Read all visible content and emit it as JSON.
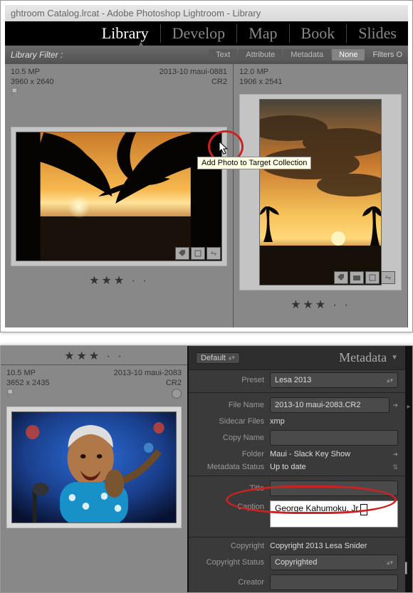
{
  "window": {
    "title": "ghtroom Catalog.lrcat - Adobe Photoshop Lightroom - Library"
  },
  "modules": {
    "items": [
      "Library",
      "Develop",
      "Map",
      "Book",
      "Slides"
    ],
    "active": "Library"
  },
  "filterbar": {
    "label": "Library Filter :",
    "tabs": [
      "Text",
      "Attribute",
      "Metadata",
      "None"
    ],
    "selected": "None",
    "right": "Filters O"
  },
  "grid": {
    "thumbs": [
      {
        "mp": "10.5 MP",
        "name": "2013-10 maui-0881",
        "dims": "3960 x 2640",
        "ext": "CR2",
        "stars": "★★★ · ·",
        "tooltip": "Add Photo to Target Collection"
      },
      {
        "mp": "12.0 MP",
        "name": "",
        "dims": "1906 x 2541",
        "ext": "",
        "stars": "★★★ · ·"
      }
    ]
  },
  "lower": {
    "thumb": {
      "mp": "10.5 MP",
      "name": "2013-10 maui-2083",
      "dims": "3652 x 2435",
      "ext": "CR2",
      "stars": "★★★ · ·"
    },
    "panel": {
      "title": "Metadata",
      "headerSelect": "Default",
      "rows": {
        "preset_lbl": "Preset",
        "preset_val": "Lesa 2013",
        "filename_lbl": "File Name",
        "filename_val": "2013-10 maui-2083.CR2",
        "sidecar_lbl": "Sidecar Files",
        "sidecar_val": "xmp",
        "copyname_lbl": "Copy Name",
        "copyname_val": "",
        "folder_lbl": "Folder",
        "folder_val": "Maui - Slack Key Show",
        "mstatus_lbl": "Metadata Status",
        "mstatus_val": "Up to date",
        "title_lbl": "Title",
        "title_val": "",
        "caption_lbl": "Caption",
        "caption_val": "George Kahumoku, Jr.",
        "copyright_lbl": "Copyright",
        "copyright_val": "Copyright 2013 Lesa Snider",
        "cstatus_lbl": "Copyright Status",
        "cstatus_val": "Copyrighted",
        "creator_lbl": "Creator",
        "creator_val": ""
      }
    }
  }
}
